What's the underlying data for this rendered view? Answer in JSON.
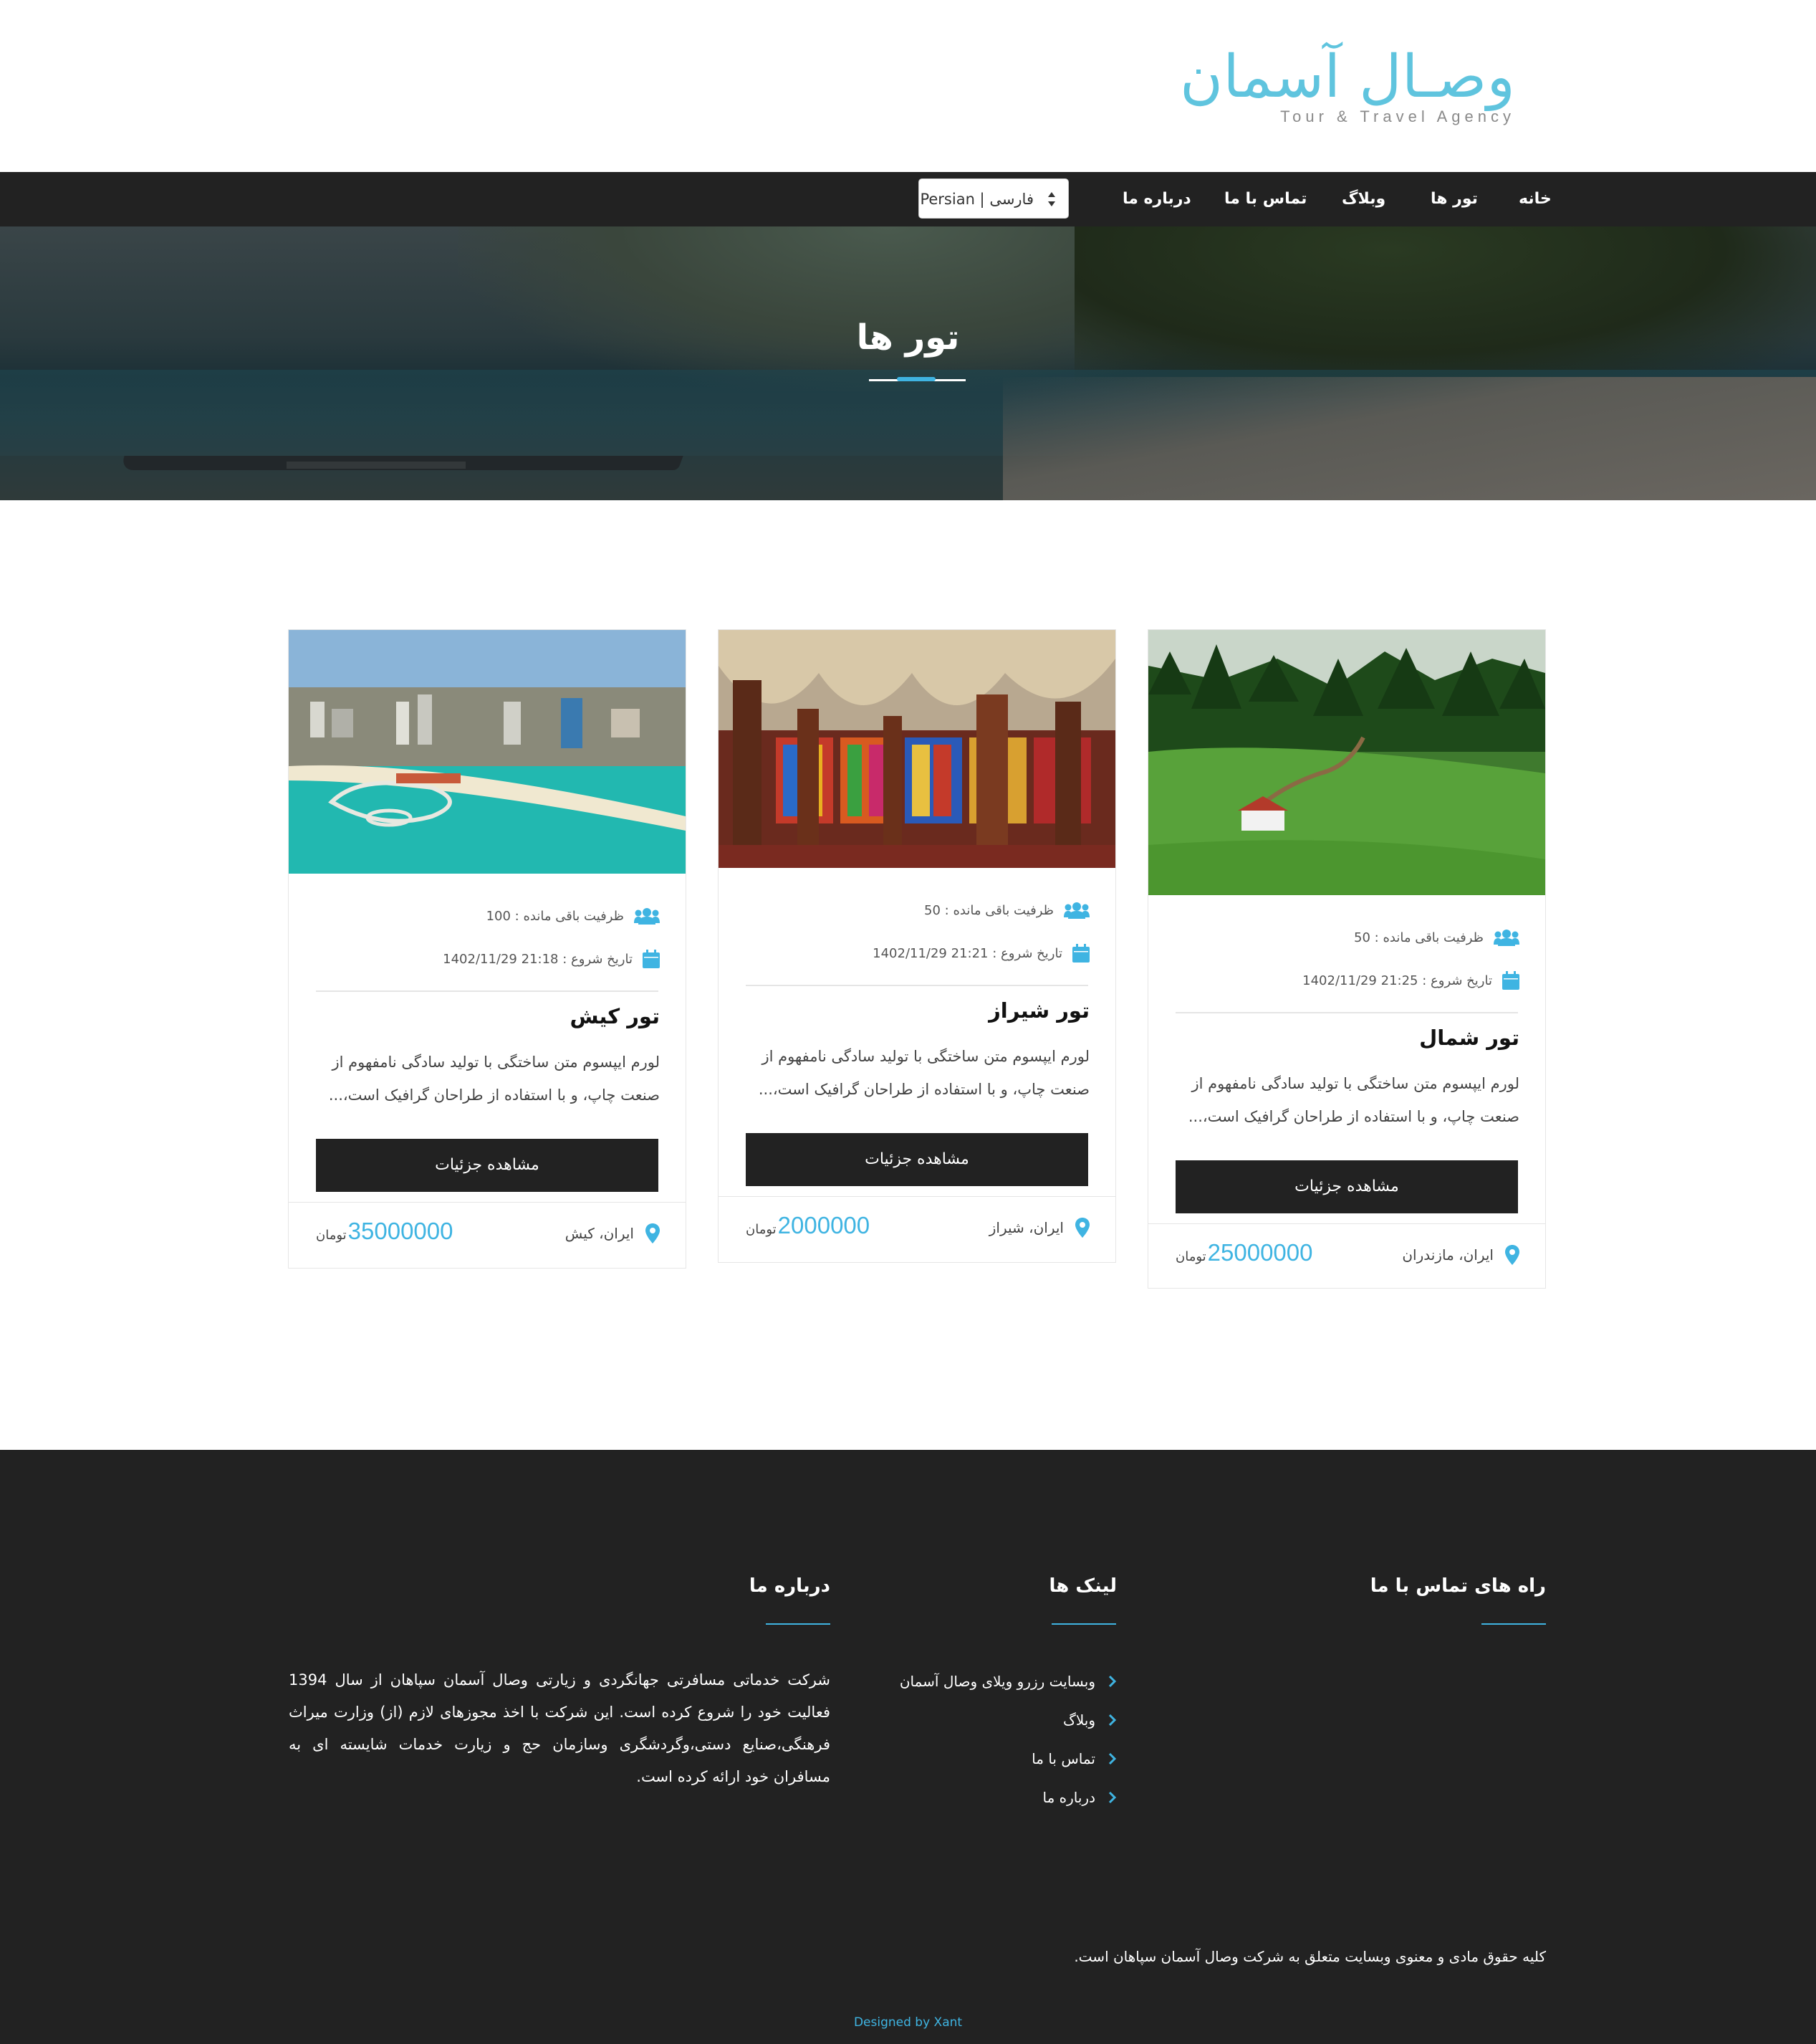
{
  "logo": {
    "script_text": "وصـال آسمان",
    "subtitle": "Tour & Travel Agency"
  },
  "nav": {
    "items": [
      {
        "label": "خانه"
      },
      {
        "label": "تور ها"
      },
      {
        "label": "وبلاگ"
      },
      {
        "label": "تماس با ما"
      },
      {
        "label": "درباره ما"
      }
    ],
    "language_select": {
      "value": "Persian | فارسی"
    }
  },
  "hero": {
    "title": "تور ها"
  },
  "tours": [
    {
      "title": "تور شمال",
      "capacity": "ظرفیت باقی مانده : 50",
      "start_date": "تاریخ شروع : 21:25 1402/11/29",
      "description": "لورم ایپسوم متن ساختگی با تولید سادگی نامفهوم از صنعت چاپ، و با استفاده از طراحان گرافیک است،...",
      "button_label": "مشاهده جزئیات",
      "location": "ایران، مازندران",
      "price": "25000000",
      "currency": "تومان"
    },
    {
      "title": "تور شیراز",
      "capacity": "ظرفیت باقی مانده : 50",
      "start_date": "تاریخ شروع : 21:21 1402/11/29",
      "description": "لورم ایپسوم متن ساختگی با تولید سادگی نامفهوم از صنعت چاپ، و با استفاده از طراحان گرافیک است،...",
      "button_label": "مشاهده جزئیات",
      "location": "ایران، شیراز",
      "price": "2000000",
      "currency": "تومان"
    },
    {
      "title": "تور کیش",
      "capacity": "ظرفیت باقی مانده : 100",
      "start_date": "تاریخ شروع : 21:18 1402/11/29",
      "description": "لورم ایپسوم متن ساختگی با تولید سادگی نامفهوم از صنعت چاپ، و با استفاده از طراحان گرافیک است،...",
      "button_label": "مشاهده جزئیات",
      "location": "ایران، کیش",
      "price": "35000000",
      "currency": "تومان"
    }
  ],
  "footer": {
    "contact_heading": "راه های تماس با ما",
    "links_heading": "لینک ها",
    "about_heading": "درباره ما",
    "links": [
      {
        "label": "وبسایت رزرو ویلای وصال آسمان"
      },
      {
        "label": "وبلاگ"
      },
      {
        "label": "تماس با ما"
      },
      {
        "label": "درباره ما"
      }
    ],
    "about_text": "شرکت خدماتی مسافرتی جهانگردی و زیارتی وصال آسمان سپاهان از سال 1394 فعالیت خود را شروع کرده است. این شرکت با اخذ مجوزهای لازم (از) وزارت میراث فرهنگی،صنایع دستی،وگردشگری وسازمان حج و زیارت خدمات شایسته ای به مسافران خود ارائه کرده است.",
    "copyright": "کلیه حقوق مادی و معنوی وبسایت متعلق به شرکت وصال آسمان سپاهان است.",
    "designed_by": "Designed by Xant"
  },
  "colors": {
    "accent": "#3fb4e2",
    "dark": "#222222",
    "logo": "#5fc4de"
  },
  "icons": {
    "capacity": "users-icon",
    "date": "calendar-icon",
    "location": "map-pin-icon",
    "link_bullet": "chevron-right-icon",
    "select_arrows": "sort-arrows-icon"
  }
}
